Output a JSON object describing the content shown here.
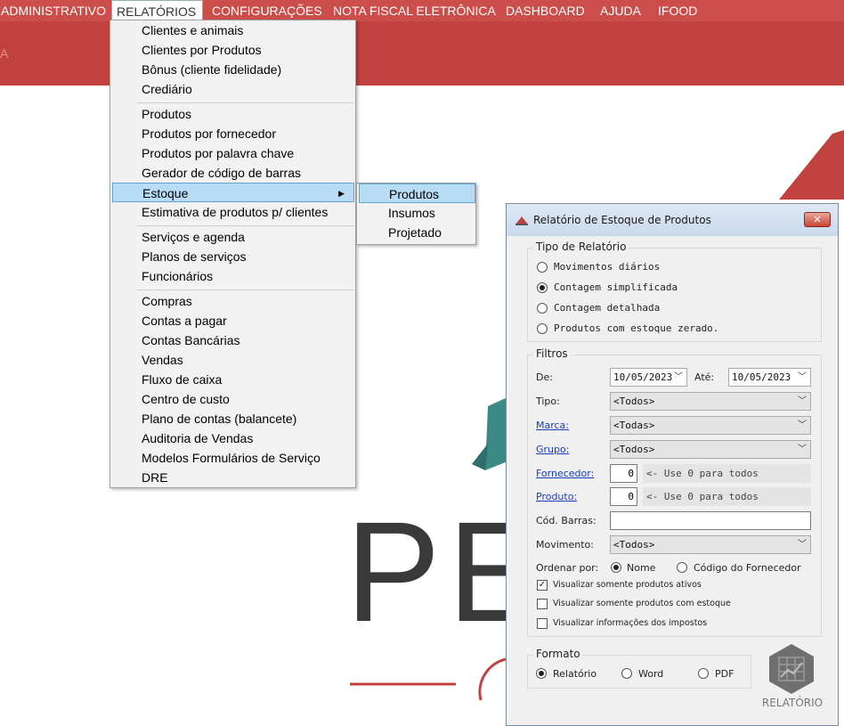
{
  "menubar": {
    "items": [
      "ADMINISTRATIVO",
      "RELATÓRIOS",
      "CONFIGURAÇÕES",
      "NOTA FISCAL ELETRÔNICA",
      "DASHBOARD",
      "AJUDA",
      "IFOOD"
    ]
  },
  "banner": {
    "partial_text": "A"
  },
  "logo": {
    "text": "PE"
  },
  "relatorios_menu": {
    "items": [
      "Clientes e animais",
      "Clientes por Produtos",
      "Bônus (cliente fidelidade)",
      "Crediário",
      "Produtos",
      "Produtos por fornecedor",
      "Produtos por palavra chave",
      "Gerador de código de barras",
      "Estoque",
      "Estimativa de produtos p/ clientes",
      "Serviços e agenda",
      "Planos de serviços",
      "Funcionários",
      "Compras",
      "Contas a pagar",
      "Contas Bancárias",
      "Vendas",
      "Fluxo de caixa",
      "Centro de custo",
      "Plano de contas (balancete)",
      "Auditoria de Vendas",
      "Modelos Formulários de Serviço",
      "DRE"
    ],
    "highlighted": "Estoque"
  },
  "estoque_submenu": {
    "items": [
      "Produtos",
      "Insumos",
      "Projetado"
    ],
    "highlighted": "Produtos"
  },
  "dialog": {
    "title": "Relatório de Estoque de Produtos",
    "close_label": "✕",
    "tipo_relatorio": {
      "title": "Tipo de Relatório",
      "options": [
        "Movimentos diários",
        "Contagem simplificada",
        "Contagem detalhada",
        "Produtos com estoque zerado."
      ],
      "selected": "Contagem simplificada"
    },
    "filtros": {
      "title": "Filtros",
      "de_label": "De:",
      "de_value": "10/05/2023",
      "ate_label": "Até:",
      "ate_value": "10/05/2023",
      "tipo_label": "Tipo:",
      "tipo_value": "<Todos>",
      "marca_label": "Marca:",
      "marca_value": "<Todas>",
      "grupo_label": "Grupo:",
      "grupo_value": "<Todos>",
      "fornecedor_label": "Fornecedor:",
      "fornecedor_value": "0",
      "fornecedor_hint": "<- Use 0 para todos",
      "produto_label": "Produto:",
      "produto_value": "0",
      "produto_hint": "<- Use 0 para todos",
      "barras_label": "Cód. Barras:",
      "barras_value": "",
      "movimento_label": "Movimento:",
      "movimento_value": "<Todos>",
      "ordenar_label": "Ordenar por:",
      "ordenar_options": [
        "Nome",
        "Código do Fornecedor"
      ],
      "ordenar_selected": "Nome",
      "checks": [
        {
          "label": "Visualizar somente produtos ativos",
          "checked": true
        },
        {
          "label": "Visualizar somente produtos com estoque",
          "checked": false
        },
        {
          "label": "Visualizar informações dos impostos",
          "checked": false
        }
      ]
    },
    "formato": {
      "title": "Formato",
      "options": [
        "Relatório",
        "Word",
        "PDF"
      ],
      "selected": "Relatório"
    },
    "relatorio_button_label": "RELATÓRIO"
  },
  "colors": {
    "menubar": "#cc4e4a",
    "banner": "#c0413e",
    "highlight": "#b9dcf6",
    "link": "#1a3dbf"
  }
}
